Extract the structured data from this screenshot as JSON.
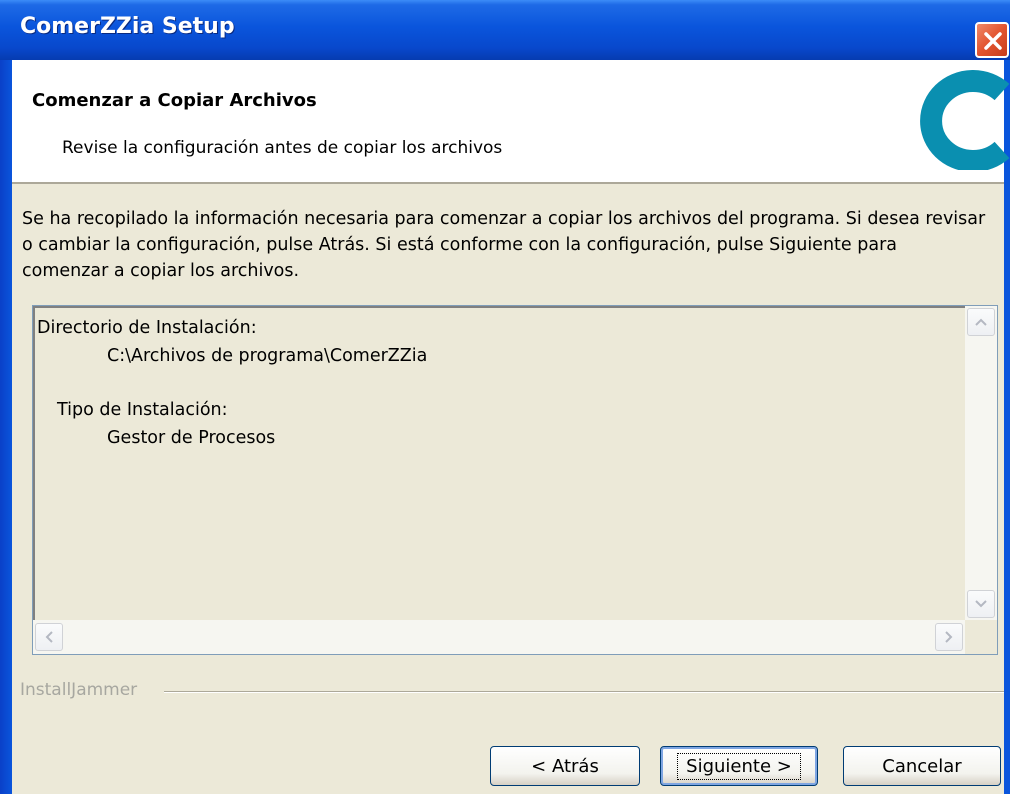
{
  "window": {
    "title": "ComerZZia Setup"
  },
  "header": {
    "title": "Comenzar a Copiar Archivos",
    "subtitle": "Revise la configuración antes de copiar los archivos",
    "logo_letter": "C",
    "logo_color": "#0a8fb0"
  },
  "description": "Se ha recopilado la información necesaria para comenzar a copiar los archivos del programa. Si desea revisar o cambiar la configuración, pulse Atrás. Si está conforme con la configuración, pulse Siguiente para comenzar a copiar los archivos.",
  "summary": {
    "lines": [
      "Directorio de Instalación:",
      "C:\\Archivos de programa\\ComerZZia",
      "Tipo de Instalación:",
      "Gestor de Procesos"
    ]
  },
  "group_label": "InstallJammer",
  "buttons": {
    "back": "< Atrás",
    "next": "Siguiente >",
    "cancel": "Cancelar"
  }
}
